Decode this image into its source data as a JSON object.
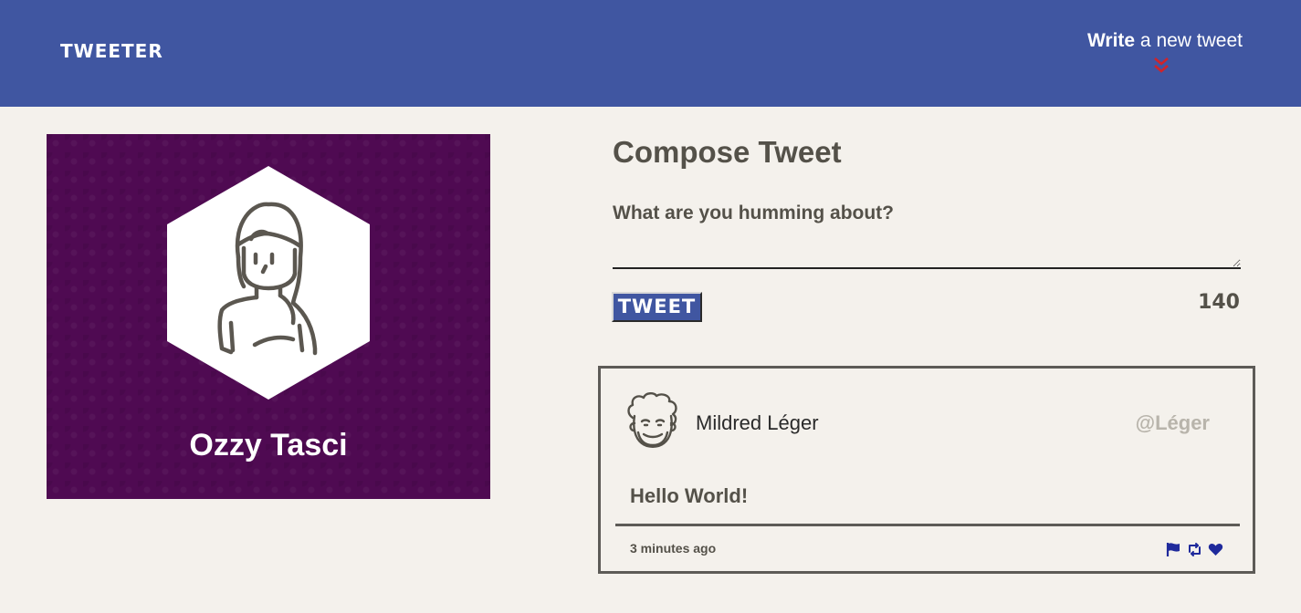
{
  "header": {
    "brand": "TWEETER",
    "write_bold": "Write",
    "write_rest": " a new tweet",
    "chevron_icon": "double-chevron-down-icon",
    "bg_color": "#4056a1",
    "chevron_color": "#d0232a"
  },
  "profile": {
    "name": "Ozzy Tasci",
    "avatar_icon": "woman-avatar-icon",
    "bg_color": "#4f0a52"
  },
  "compose": {
    "title": "Compose Tweet",
    "placeholder": "What are you humming about?",
    "value": "",
    "button_label": "TWEET",
    "counter": "140"
  },
  "tweets": [
    {
      "avatar_icon": "curly-hair-man-avatar-icon",
      "name": "Mildred Léger",
      "handle": "@Léger",
      "body": "Hello World!",
      "time": "3 minutes ago",
      "actions": [
        "flag-icon",
        "retweet-icon",
        "heart-icon"
      ],
      "action_color": "#1f2a9c"
    }
  ]
}
